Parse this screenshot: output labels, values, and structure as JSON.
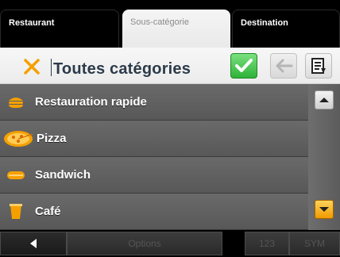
{
  "tabs": [
    {
      "label": "Restaurant",
      "active": false
    },
    {
      "label": "Sous-catégorie",
      "active": true
    },
    {
      "label": "Destination",
      "active": false
    }
  ],
  "header": {
    "title": "Toutes catégories"
  },
  "list": {
    "items": [
      {
        "label": "Restauration rapide",
        "icon": "burger-icon"
      },
      {
        "label": "Pizza",
        "icon": "pizza-icon"
      },
      {
        "label": "Sandwich",
        "icon": "sandwich-icon"
      },
      {
        "label": "Café",
        "icon": "coffee-cup-icon"
      }
    ]
  },
  "bottom_bar": {
    "options_label": "Options",
    "numeric_label": "123",
    "symbols_label": "SYM"
  },
  "colors": {
    "accent_orange": "#f5a000",
    "ok_green": "#2fb239"
  }
}
